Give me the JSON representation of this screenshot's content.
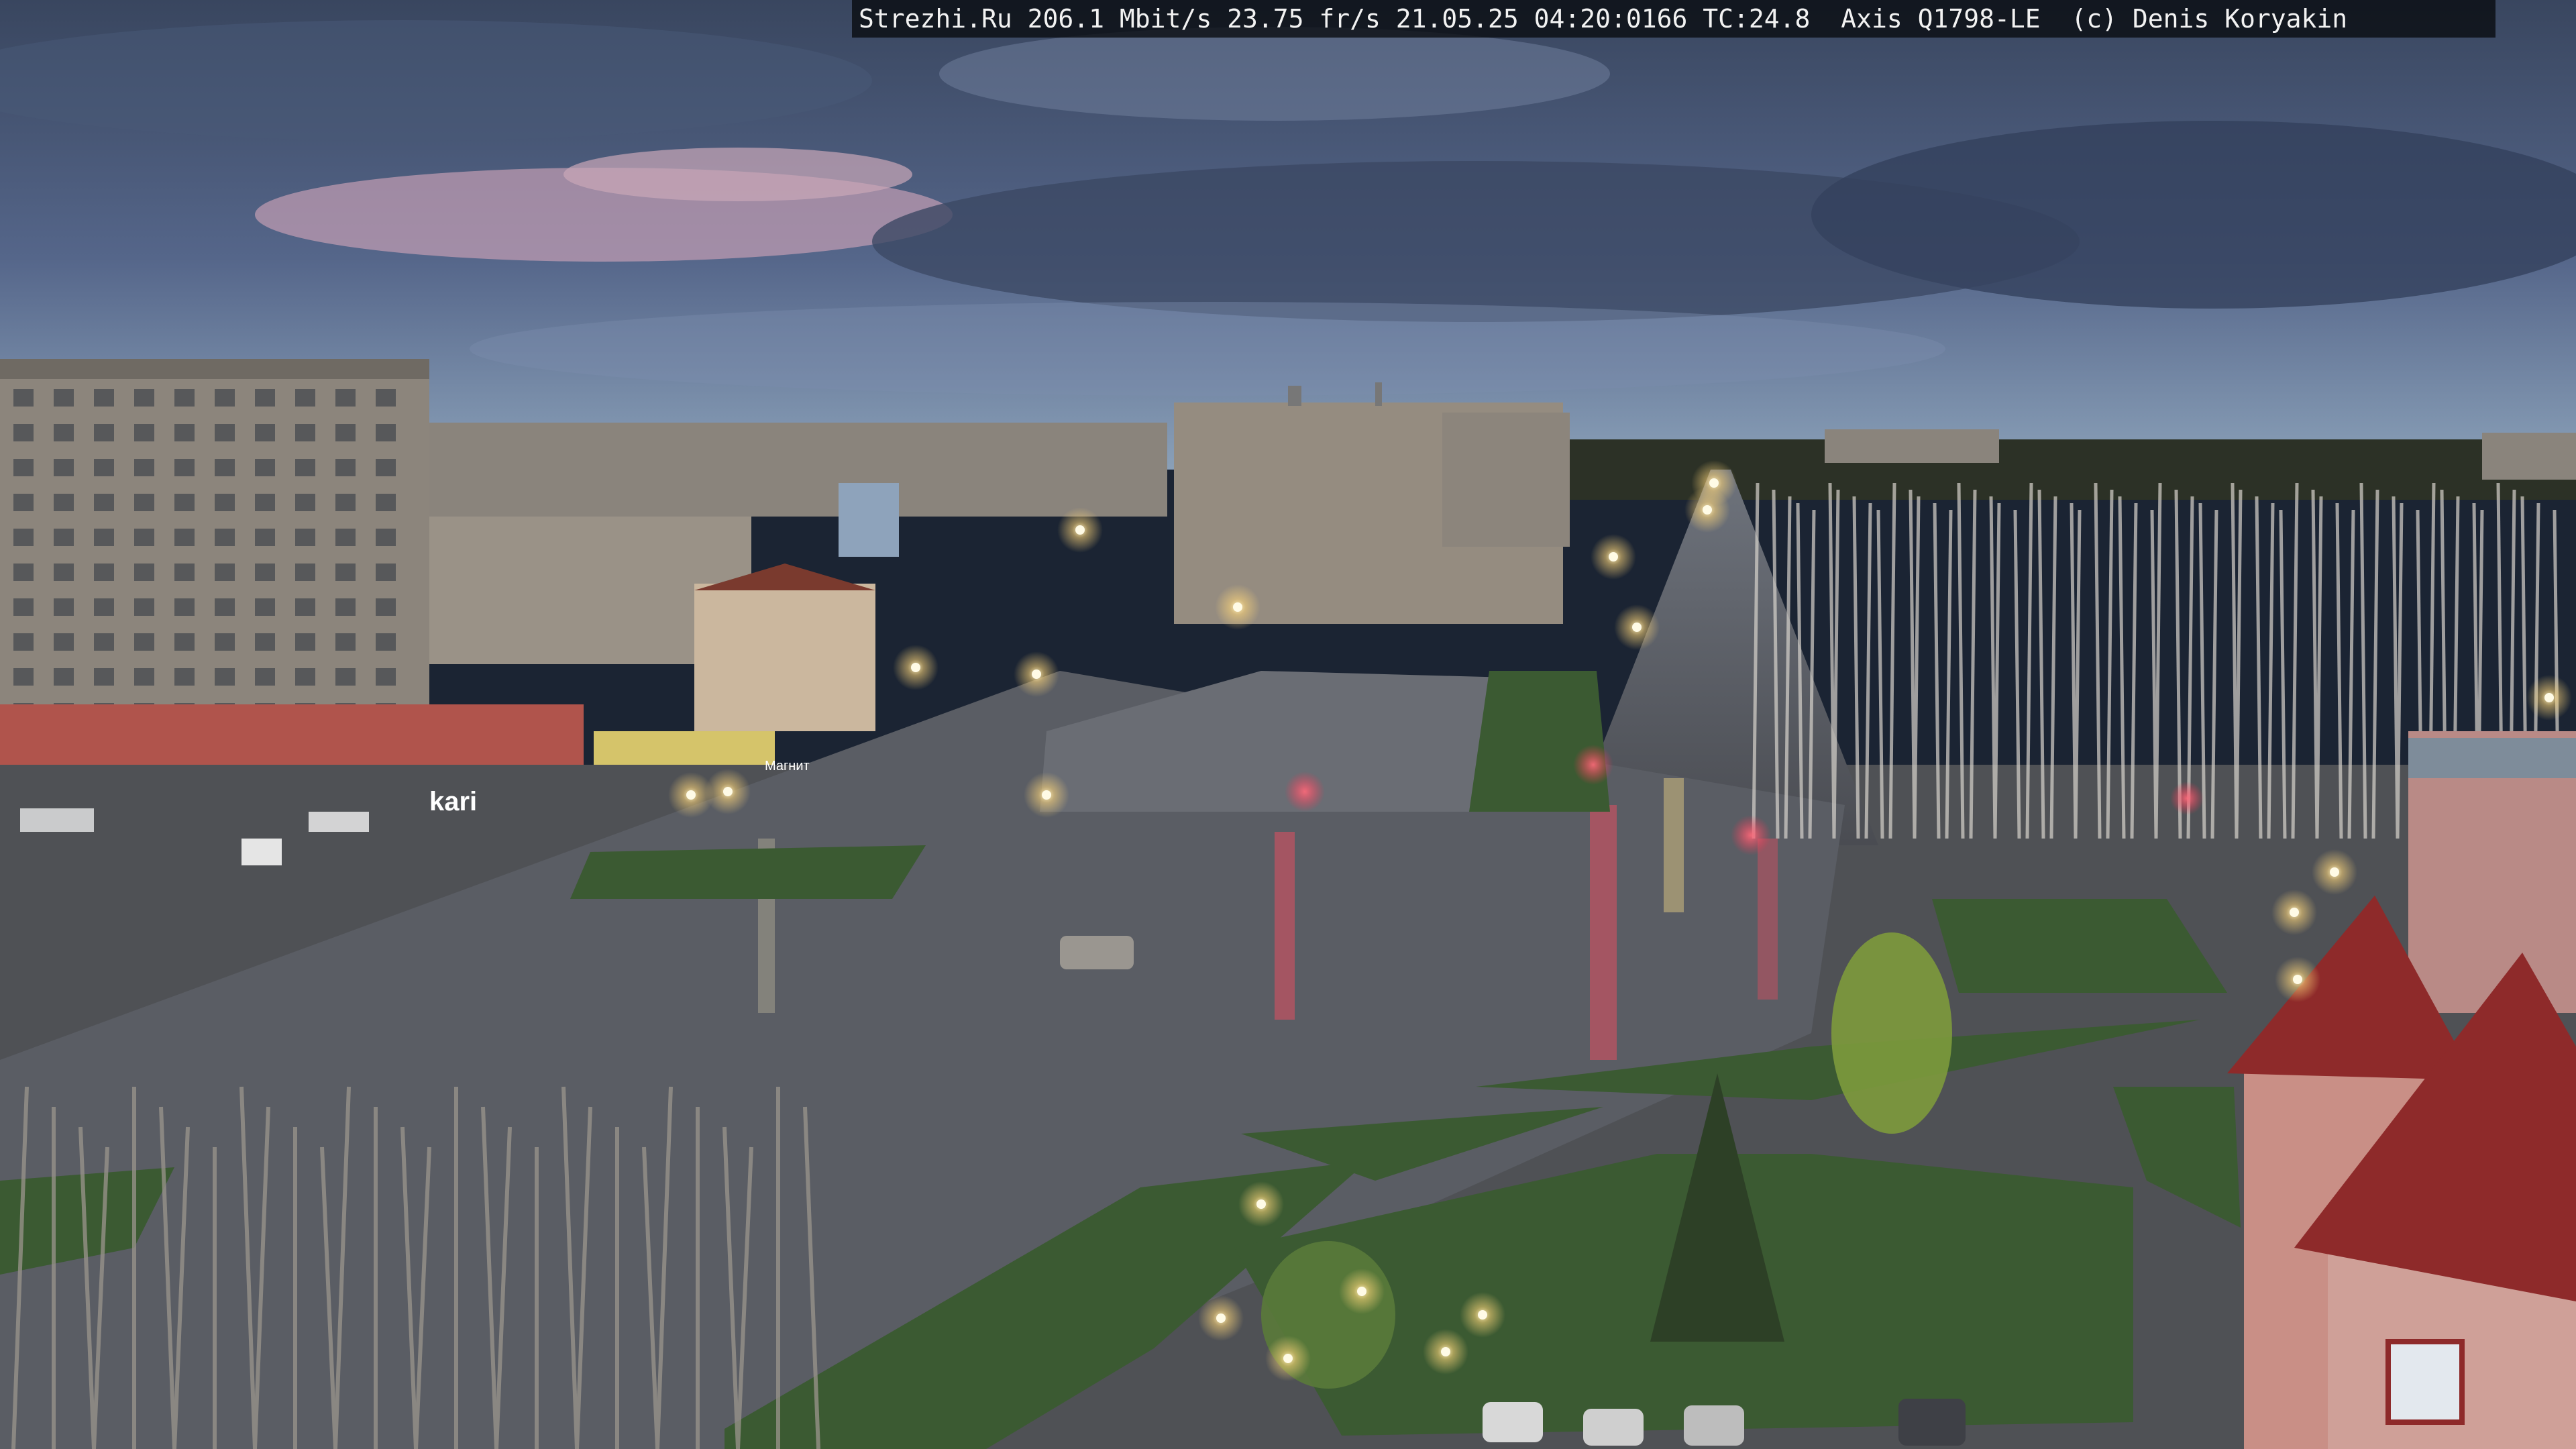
{
  "camera_overlay": {
    "text": "Strezhi.Ru 206.1 Mbit/s 23.75 fr/s 21.05.25 04:20:0166 TC:24.8  Axis Q1798-LE  (c) Denis Koryakin"
  },
  "signs": {
    "shop_left": "kari",
    "shop_center": "Магнит"
  },
  "colors": {
    "sky_top": "#3a4a66",
    "sky_horizon": "#8aa0b8",
    "cloud_pink": "#c9a2b5",
    "building_gray": "#8c857c",
    "shop_red": "#b0544c",
    "asphalt": "#5b5e66",
    "grass": "#3b5a32",
    "street_light": "#ffe9a8",
    "roof_red": "#8e2a2a"
  }
}
